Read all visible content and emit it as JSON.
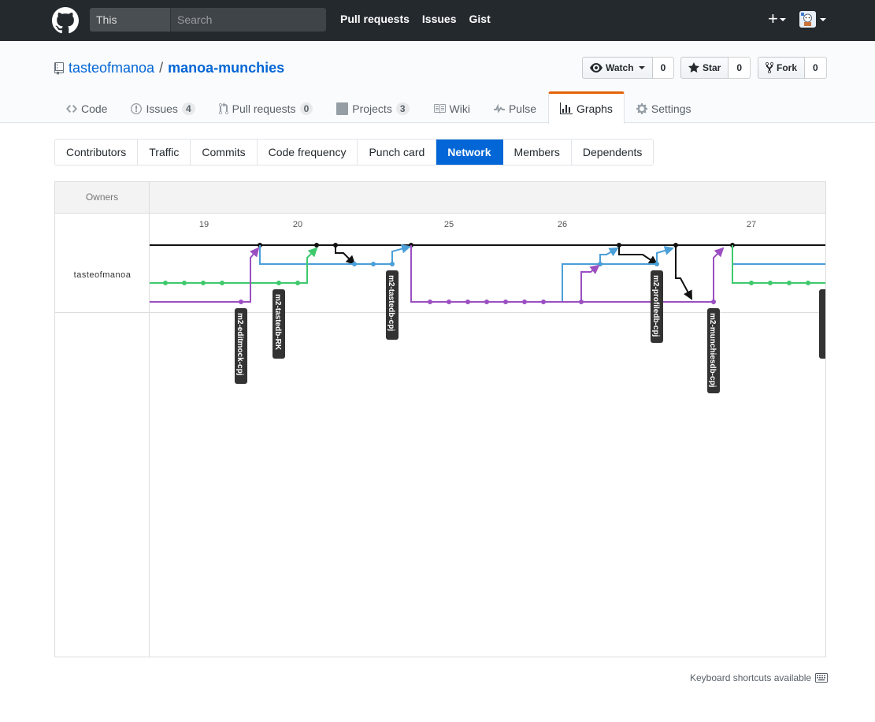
{
  "header": {
    "search_scope": "This repository",
    "search_placeholder": "Search",
    "nav": [
      "Pull requests",
      "Issues",
      "Gist"
    ]
  },
  "repo": {
    "owner": "tasteofmanoa",
    "separator": "/",
    "name": "manoa-munchies",
    "actions": {
      "watch_label": "Watch",
      "watch_count": "0",
      "star_label": "Star",
      "star_count": "0",
      "fork_label": "Fork",
      "fork_count": "0"
    },
    "tabs": [
      {
        "label": "Code",
        "icon": "code-icon",
        "count": ""
      },
      {
        "label": "Issues",
        "icon": "issue-opened-icon",
        "count": "4"
      },
      {
        "label": "Pull requests",
        "icon": "git-pull-request-icon",
        "count": "0"
      },
      {
        "label": "Projects",
        "icon": "project-icon",
        "count": "3"
      },
      {
        "label": "Wiki",
        "icon": "book-icon",
        "count": ""
      },
      {
        "label": "Pulse",
        "icon": "pulse-icon",
        "count": ""
      },
      {
        "label": "Graphs",
        "icon": "graph-icon",
        "count": "",
        "selected": true
      },
      {
        "label": "Settings",
        "icon": "gear-icon",
        "count": ""
      }
    ]
  },
  "graph_tabs": [
    "Contributors",
    "Traffic",
    "Commits",
    "Code frequency",
    "Punch card",
    "Network",
    "Members",
    "Dependents"
  ],
  "selected_graph_tab": "Network",
  "network": {
    "owners_label": "Owners",
    "owner": "tasteofmanoa",
    "dates": [
      "19",
      "20",
      "25",
      "26",
      "27"
    ],
    "branch_labels": [
      "m2-editmock-cpj",
      "m2-tastedb-RK",
      "m2-tastedb-cpj",
      "m2-profiledb-cpj",
      "m2-munchiesdb-cpj"
    ],
    "colors": {
      "master": "#111111",
      "blue": "#4a9fd8",
      "green": "#3ec96d",
      "purple": "#9b4fc2"
    }
  },
  "footer": {
    "keyboard_note": "Keyboard shortcuts available"
  }
}
